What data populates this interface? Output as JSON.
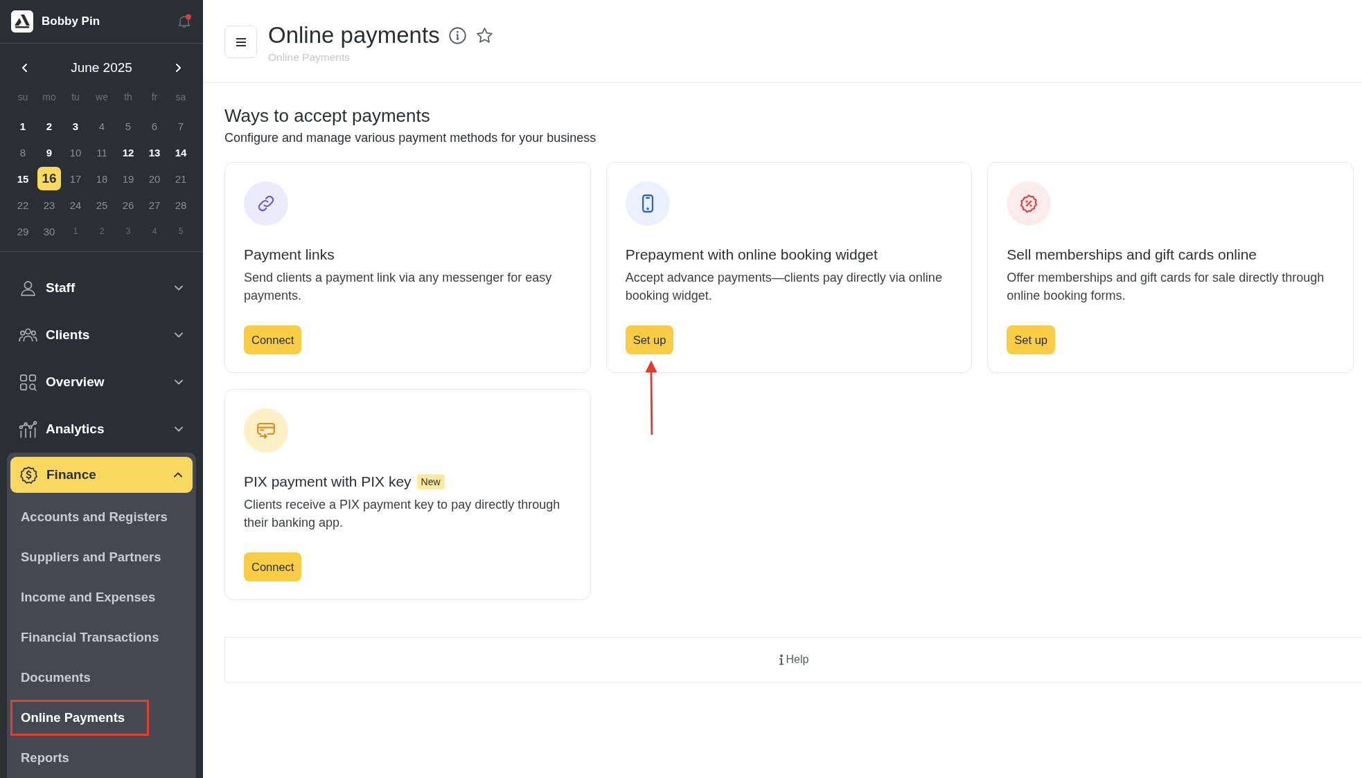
{
  "sidebar": {
    "user": {
      "name": "Bobby Pin",
      "notification": true
    },
    "calendar": {
      "month": "June 2025",
      "weekdays": [
        "su",
        "mo",
        "tu",
        "we",
        "th",
        "fr",
        "sa"
      ],
      "days": [
        {
          "day": "1",
          "kind": "month",
          "marked": true,
          "selected": false
        },
        {
          "day": "2",
          "kind": "month",
          "marked": true,
          "selected": false
        },
        {
          "day": "3",
          "kind": "month",
          "marked": true,
          "selected": false
        },
        {
          "day": "4",
          "kind": "month",
          "marked": false,
          "selected": false
        },
        {
          "day": "5",
          "kind": "month",
          "marked": false,
          "selected": false
        },
        {
          "day": "6",
          "kind": "month",
          "marked": false,
          "selected": false
        },
        {
          "day": "7",
          "kind": "month",
          "marked": false,
          "selected": false
        },
        {
          "day": "8",
          "kind": "month",
          "marked": false,
          "selected": false
        },
        {
          "day": "9",
          "kind": "month",
          "marked": true,
          "selected": false
        },
        {
          "day": "10",
          "kind": "month",
          "marked": false,
          "selected": false
        },
        {
          "day": "11",
          "kind": "month",
          "marked": false,
          "selected": false
        },
        {
          "day": "12",
          "kind": "month",
          "marked": true,
          "selected": false
        },
        {
          "day": "13",
          "kind": "month",
          "marked": true,
          "selected": false
        },
        {
          "day": "14",
          "kind": "month",
          "marked": true,
          "selected": false
        },
        {
          "day": "15",
          "kind": "month",
          "marked": true,
          "selected": false
        },
        {
          "day": "16",
          "kind": "month",
          "marked": true,
          "selected": true
        },
        {
          "day": "17",
          "kind": "month",
          "marked": false,
          "selected": false
        },
        {
          "day": "18",
          "kind": "month",
          "marked": false,
          "selected": false
        },
        {
          "day": "19",
          "kind": "month",
          "marked": false,
          "selected": false
        },
        {
          "day": "20",
          "kind": "month",
          "marked": false,
          "selected": false
        },
        {
          "day": "21",
          "kind": "month",
          "marked": false,
          "selected": false
        },
        {
          "day": "22",
          "kind": "month",
          "marked": false,
          "selected": false
        },
        {
          "day": "23",
          "kind": "month",
          "marked": false,
          "selected": false
        },
        {
          "day": "24",
          "kind": "month",
          "marked": false,
          "selected": false
        },
        {
          "day": "25",
          "kind": "month",
          "marked": false,
          "selected": false
        },
        {
          "day": "26",
          "kind": "month",
          "marked": false,
          "selected": false
        },
        {
          "day": "27",
          "kind": "month",
          "marked": false,
          "selected": false
        },
        {
          "day": "28",
          "kind": "month",
          "marked": false,
          "selected": false
        },
        {
          "day": "29",
          "kind": "month",
          "marked": false,
          "selected": false
        },
        {
          "day": "30",
          "kind": "month",
          "marked": false,
          "selected": false
        },
        {
          "day": "1",
          "kind": "other",
          "marked": false,
          "selected": false
        },
        {
          "day": "2",
          "kind": "other",
          "marked": false,
          "selected": false
        },
        {
          "day": "3",
          "kind": "other",
          "marked": false,
          "selected": false
        },
        {
          "day": "4",
          "kind": "other",
          "marked": false,
          "selected": false
        },
        {
          "day": "5",
          "kind": "other",
          "marked": false,
          "selected": false
        }
      ]
    },
    "nav": [
      {
        "label": "Staff",
        "expanded": false
      },
      {
        "label": "Clients",
        "expanded": false
      },
      {
        "label": "Overview",
        "expanded": false
      },
      {
        "label": "Analytics",
        "expanded": false
      },
      {
        "label": "Finance",
        "expanded": true,
        "children": [
          {
            "label": "Accounts and Registers",
            "selected": false
          },
          {
            "label": "Suppliers and Partners",
            "selected": false
          },
          {
            "label": "Income and Expenses",
            "selected": false
          },
          {
            "label": "Financial Transactions",
            "selected": false
          },
          {
            "label": "Documents",
            "selected": false
          },
          {
            "label": "Online Payments",
            "selected": true
          },
          {
            "label": "Reports",
            "selected": false
          }
        ]
      }
    ]
  },
  "header": {
    "title": "Online payments",
    "breadcrumb": "Online Payments",
    "favorite": false
  },
  "section": {
    "title": "Ways to accept payments",
    "subtitle": "Configure and manage various payment methods for your business"
  },
  "cards": [
    {
      "title": "Payment links",
      "description": "Send clients a payment link via any messenger for easy payments.",
      "button": "Connect"
    },
    {
      "title": "Prepayment with online booking widget",
      "description": "Accept advance payments—clients pay directly via online booking widget.",
      "button": "Set up"
    },
    {
      "title": "Sell memberships and gift cards online",
      "description": "Offer memberships and gift cards for sale directly through online booking forms.",
      "button": "Set up"
    },
    {
      "title": "PIX payment with PIX key",
      "badge": "New",
      "description": "Clients receive a PIX payment key to pay directly through their banking app.",
      "button": "Connect"
    }
  ],
  "footer": {
    "help": "Help"
  }
}
